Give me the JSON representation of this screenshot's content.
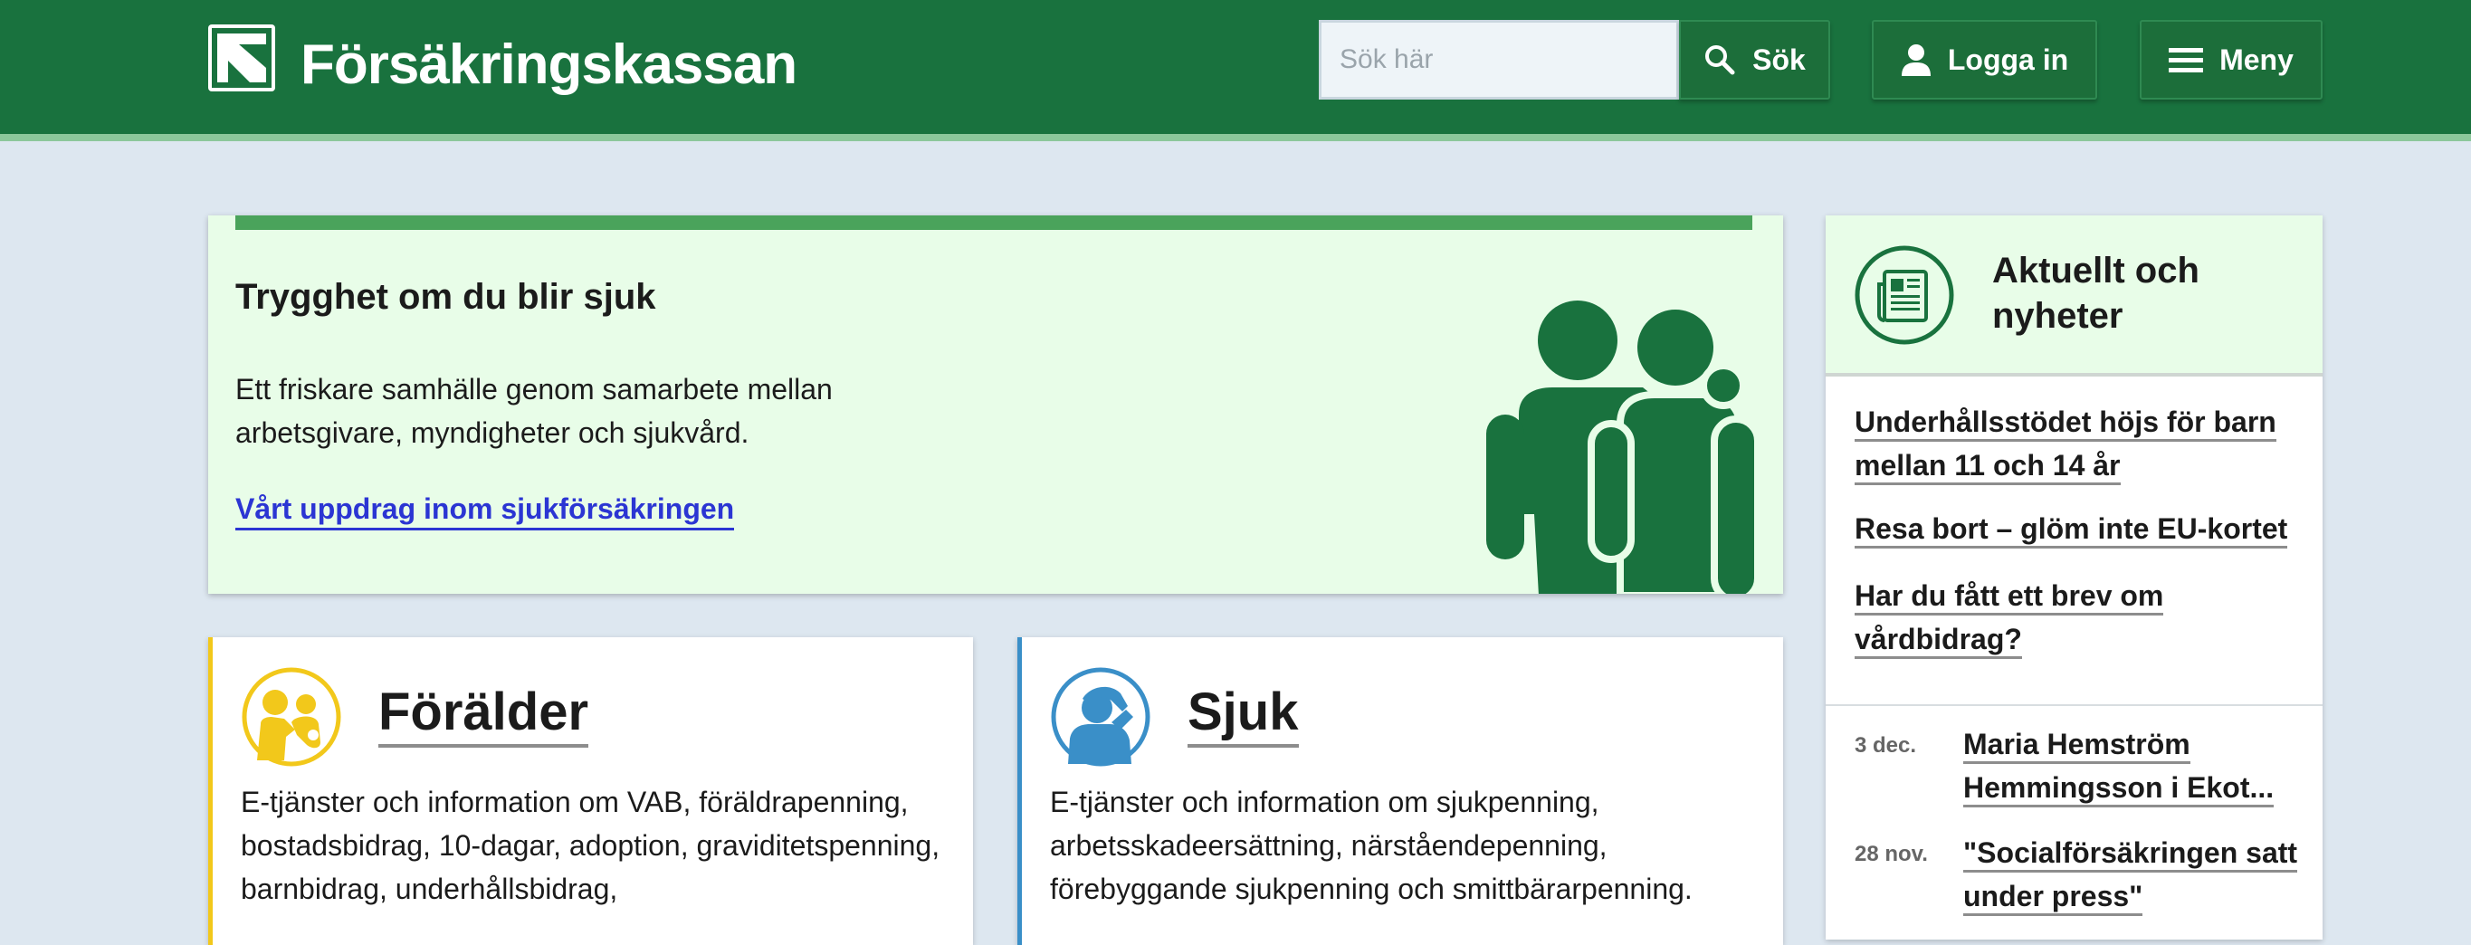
{
  "header": {
    "brand": "Försäkringskassan",
    "search_placeholder": "Sök här",
    "search_label": "Sök",
    "login_label": "Logga in",
    "menu_label": "Meny",
    "icons": [
      "logo-icon",
      "search-icon",
      "user-icon",
      "hamburger-icon"
    ]
  },
  "hero": {
    "title": "Trygghet om du blir sjuk",
    "text": "Ett friskare samhälle genom samarbete mellan arbetsgivare, myndigheter och sjukvård.",
    "link": "Vårt uppdrag inom sjukförsäkringen"
  },
  "categories": [
    {
      "title": "Förälder",
      "text": "E-tjänster och information om VAB, föräldrapenning, bostadsbidrag, 10-dagar, adoption, graviditetspenning, barnbidrag, underhållsbidrag,",
      "icon": "parent-child-icon",
      "accent": "#f2c81b"
    },
    {
      "title": "Sjuk",
      "text": "E-tjänster och information om sjukpenning, arbetsskadeersättning, närståendepenning, förebyggande sjukpenning och smittbärarpenning.",
      "icon": "sick-person-icon",
      "accent": "#3a8fc8"
    }
  ],
  "news": {
    "title": "Aktuellt och nyheter",
    "icon": "newspaper-icon",
    "links": [
      "Underhållsstödet höjs för barn mellan 11 och 14 år",
      "Resa bort – glöm inte EU-kortet",
      "Har du fått ett brev om vårdbidrag?"
    ],
    "items": [
      {
        "date": "3 dec.",
        "title": "Maria Hemström Hemmingsson i Ekot..."
      },
      {
        "date": "28 nov.",
        "title": "\"Socialförsäkringen satt under press\""
      }
    ]
  },
  "colors": {
    "header": "#19723e",
    "header_stripe": "#8cc79b",
    "page_background": "#dde7f0",
    "hero_background": "#e8fde8",
    "hero_bar": "#4aa35b",
    "link": "#2b35d3"
  }
}
